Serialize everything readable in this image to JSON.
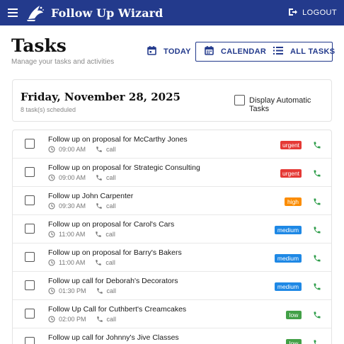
{
  "app": {
    "title": "Follow Up Wizard",
    "logout_label": "LOGOUT",
    "brand_color": "#233a8c",
    "icons": {
      "menu": "hamburger-menu-icon",
      "logo": "wizard-logo-icon",
      "logout": "logout-icon"
    }
  },
  "header": {
    "title": "Tasks",
    "subtitle": "Manage your tasks and activities",
    "views": [
      {
        "label": "TODAY",
        "icon": "calendar-today-icon"
      },
      {
        "label": "CALENDAR",
        "icon": "calendar-grid-icon"
      },
      {
        "label": "ALL TASKS",
        "icon": "list-icon"
      }
    ]
  },
  "day": {
    "date_label": "Friday, November 28, 2025",
    "count_label": "8 task(s) scheduled",
    "auto_tasks_label": "Display Automatic Tasks",
    "auto_tasks_checked": false
  },
  "priority_colors": {
    "urgent": "#e53935",
    "high": "#fb8c00",
    "medium": "#1e88e5",
    "low": "#43a047"
  },
  "tasks": [
    {
      "title": "Follow up on proposal for McCarthy Jones",
      "time": "09:00 AM",
      "type": "call",
      "priority": "urgent"
    },
    {
      "title": "Follow up on proposal for Strategic Consulting",
      "time": "09:00 AM",
      "type": "call",
      "priority": "urgent"
    },
    {
      "title": "Follow up John Carpenter",
      "time": "09:30 AM",
      "type": "call",
      "priority": "high"
    },
    {
      "title": "Follow up on proposal for Carol's Cars",
      "time": "11:00 AM",
      "type": "call",
      "priority": "medium"
    },
    {
      "title": "Follow up on proposal for Barry's Bakers",
      "time": "11:00 AM",
      "type": "call",
      "priority": "medium"
    },
    {
      "title": "Follow up call for Deborah's Decorators",
      "time": "01:30 PM",
      "type": "call",
      "priority": "medium"
    },
    {
      "title": "Follow Up Call for Cuthbert's Creamcakes",
      "time": "02:00 PM",
      "type": "call",
      "priority": "low"
    },
    {
      "title": "Follow up call for Johnny's Jive Classes",
      "time": "",
      "type": "",
      "priority": "low"
    }
  ]
}
